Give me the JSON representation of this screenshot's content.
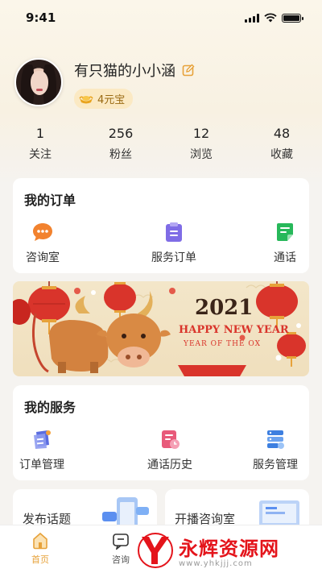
{
  "status_bar": {
    "time": "9:41"
  },
  "profile": {
    "name": "有只猫的小小涵",
    "badge": "4元宝"
  },
  "stats": [
    {
      "value": "1",
      "label": "关注"
    },
    {
      "value": "256",
      "label": "粉丝"
    },
    {
      "value": "12",
      "label": "浏览"
    },
    {
      "value": "48",
      "label": "收藏"
    }
  ],
  "orders": {
    "title": "我的订单",
    "items": [
      {
        "label": "咨询室",
        "icon": "chat-bubble-icon",
        "color": "#f2822e"
      },
      {
        "label": "服务订单",
        "icon": "clipboard-icon",
        "color": "#7f6ce6"
      },
      {
        "label": "通话",
        "icon": "document-call-icon",
        "color": "#27b85a"
      }
    ]
  },
  "banner": {
    "year": "2021",
    "headline": "HAPPY NEW YEAR",
    "subline": "YEAR OF THE OX"
  },
  "services": {
    "title": "我的服务",
    "items": [
      {
        "label": "订单管理",
        "icon": "order-manage-icon",
        "color": "#5b6de0"
      },
      {
        "label": "通话历史",
        "icon": "call-history-icon",
        "color": "#e85a7a"
      },
      {
        "label": "服务管理",
        "icon": "service-manage-icon",
        "color": "#3d7fe0"
      }
    ]
  },
  "bottom_cards": [
    {
      "title": "发布话题"
    },
    {
      "title": "开播咨询室"
    }
  ],
  "tabbar": [
    {
      "label": "首页",
      "icon": "home-icon",
      "active": true
    },
    {
      "label": "咨询",
      "icon": "chat-icon",
      "active": false
    }
  ],
  "watermark": {
    "brand": "永辉资源网",
    "url": "www.yhkjjj.com"
  },
  "colors": {
    "accent": "#e7a23a",
    "banner_red": "#d9342b"
  }
}
